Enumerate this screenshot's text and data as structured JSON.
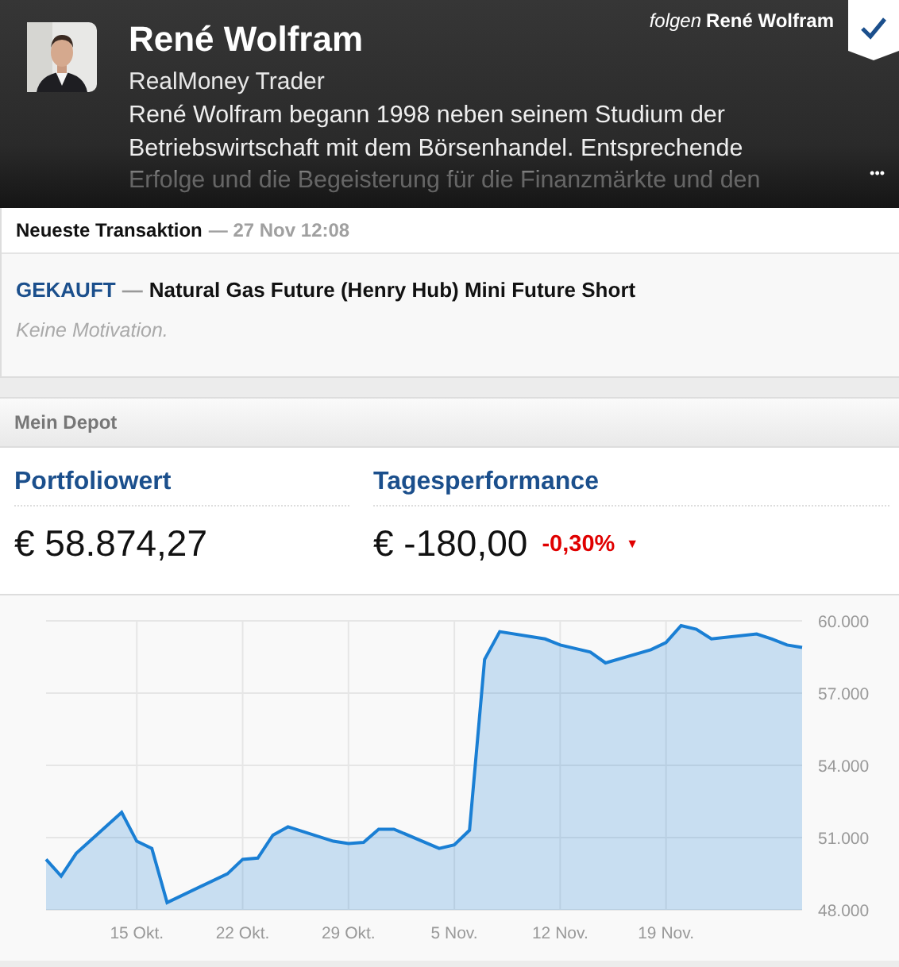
{
  "profile": {
    "name": "René Wolfram",
    "role": "RealMoney Trader",
    "bio": "René Wolfram begann 1998 neben seinem Studium der Betriebswirtschaft mit dem Börsenhandel. Entsprechende Erfolge und die Begeisterung für die Finanzmärkte und den",
    "follow_prefix": "folgen",
    "follow_name": "René Wolfram",
    "following": true,
    "more": "•••"
  },
  "transaction": {
    "label": "Neueste Transaktion",
    "time": "— 27 Nov 12:08",
    "action": "GEKAUFT",
    "separator": "—",
    "instrument": "Natural Gas Future (Henry Hub) Mini Future Short",
    "motivation": "Keine Motivation."
  },
  "depot": {
    "title": "Mein Depot",
    "stats": [
      {
        "label": "Portfoliowert",
        "value": "€ 58.874,27"
      },
      {
        "label": "Tagesperformance",
        "value": "€ -180,00",
        "change": "-0,30%",
        "arrow": "▼"
      }
    ],
    "chart_data": {
      "type": "area",
      "grid": true,
      "categories": [
        null,
        null,
        null,
        null,
        null,
        null,
        "15 Okt.",
        null,
        null,
        null,
        null,
        null,
        null,
        "22 Okt.",
        null,
        null,
        null,
        null,
        null,
        null,
        "29 Okt.",
        null,
        null,
        null,
        null,
        null,
        null,
        "5 Nov.",
        null,
        null,
        null,
        null,
        null,
        null,
        "12 Nov.",
        null,
        null,
        null,
        null,
        null,
        null,
        "19 Nov.",
        null,
        null,
        null,
        null,
        null,
        null,
        null,
        null,
        null
      ],
      "series": [
        {
          "color": "#1a7fd4",
          "values": [
            50100,
            49400,
            50350,
            null,
            null,
            52050,
            50850,
            50550,
            48300,
            null,
            null,
            null,
            49500,
            50100,
            50150,
            51100,
            51450,
            null,
            null,
            50850,
            50750,
            50800,
            51350,
            51350,
            null,
            null,
            50550,
            50700,
            51300,
            58400,
            59550,
            null,
            null,
            59250,
            59000,
            null,
            58700,
            58250,
            null,
            null,
            58800,
            59100,
            59800,
            59650,
            59250,
            null,
            null,
            59450,
            59250,
            59000,
            58900
          ]
        }
      ],
      "ylim": [
        48000,
        60000
      ],
      "yticks": [
        {
          "value": 48000,
          "label": "48.000"
        },
        {
          "value": 51000,
          "label": "51.000"
        },
        {
          "value": 54000,
          "label": "54.000"
        },
        {
          "value": 57000,
          "label": "57.000"
        },
        {
          "value": 60000,
          "label": "60.000"
        }
      ]
    }
  }
}
